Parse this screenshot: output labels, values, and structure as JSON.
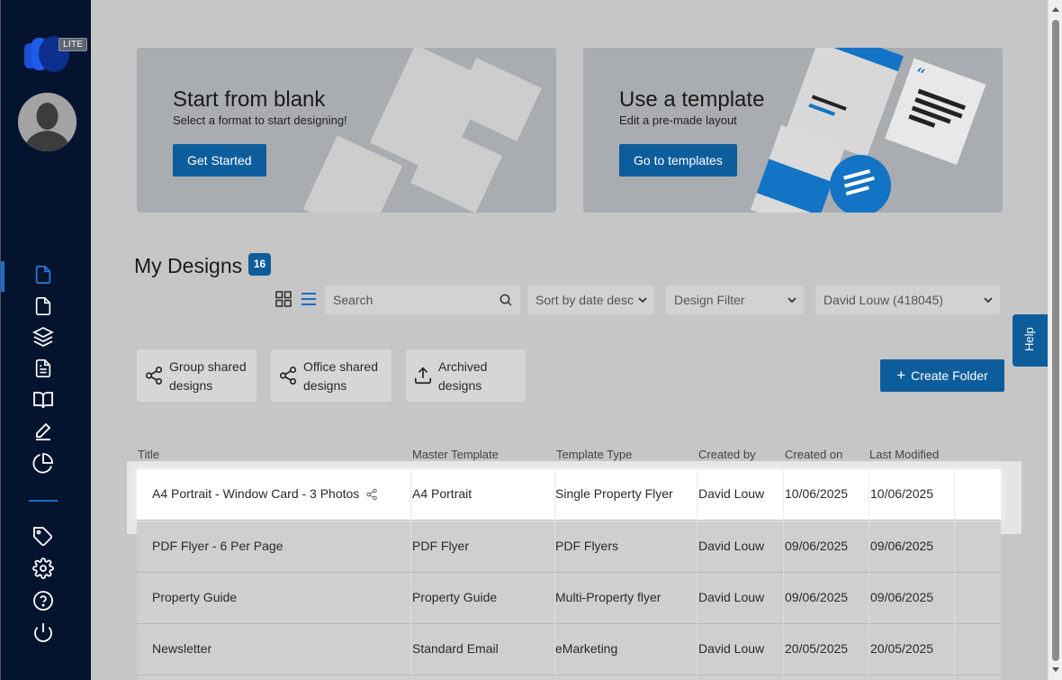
{
  "brand": {
    "badge": "LITE",
    "accent": "#0d5d9c",
    "sidebar_bg": "#04142e"
  },
  "sidebar": {
    "items": [
      {
        "name": "designs-icon",
        "active": true
      },
      {
        "name": "document-icon"
      },
      {
        "name": "layers-icon"
      },
      {
        "name": "file-text-icon"
      },
      {
        "name": "book-open-icon"
      },
      {
        "name": "edit-icon"
      },
      {
        "name": "pie-chart-icon"
      },
      {
        "name": "tag-icon"
      },
      {
        "name": "settings-icon"
      },
      {
        "name": "help-circle-icon"
      },
      {
        "name": "power-icon"
      }
    ]
  },
  "cards": [
    {
      "title": "Start from blank",
      "subtitle": "Select a format to start designing!",
      "button": "Get Started"
    },
    {
      "title": "Use a template",
      "subtitle": "Edit a pre-made layout",
      "button": "Go to templates"
    }
  ],
  "designs": {
    "title": "My Designs",
    "count": "16",
    "search_placeholder": "Search",
    "sort": "Sort by date desc",
    "filter": "Design Filter",
    "user": "David Louw (418045)",
    "tiles": [
      {
        "line1": "Group shared",
        "line2": "designs",
        "icon": "share-icon"
      },
      {
        "line1": "Office shared",
        "line2": "designs",
        "icon": "share-icon"
      },
      {
        "line1": "Archived",
        "line2": "designs",
        "icon": "upload-icon"
      }
    ],
    "create_folder": "Create Folder",
    "columns": [
      "Title",
      "Master Template",
      "Template Type",
      "Created by",
      "Created on",
      "Last Modified"
    ],
    "rows": [
      [
        "A4 Portrait - Window Card - 3 Photos",
        "A4 Portrait",
        "Single Property Flyer",
        "David Louw",
        "10/06/2025",
        "10/06/2025"
      ],
      [
        "PDF Flyer - 6 Per Page",
        "PDF Flyer",
        "PDF Flyers",
        "David Louw",
        "09/06/2025",
        "09/06/2025"
      ],
      [
        "Property Guide",
        "Property Guide",
        "Multi-Property flyer",
        "David Louw",
        "09/06/2025",
        "09/06/2025"
      ],
      [
        "Newsletter",
        "Standard Email",
        "eMarketing",
        "David Louw",
        "20/05/2025",
        "20/05/2025"
      ]
    ]
  },
  "help": "Help"
}
